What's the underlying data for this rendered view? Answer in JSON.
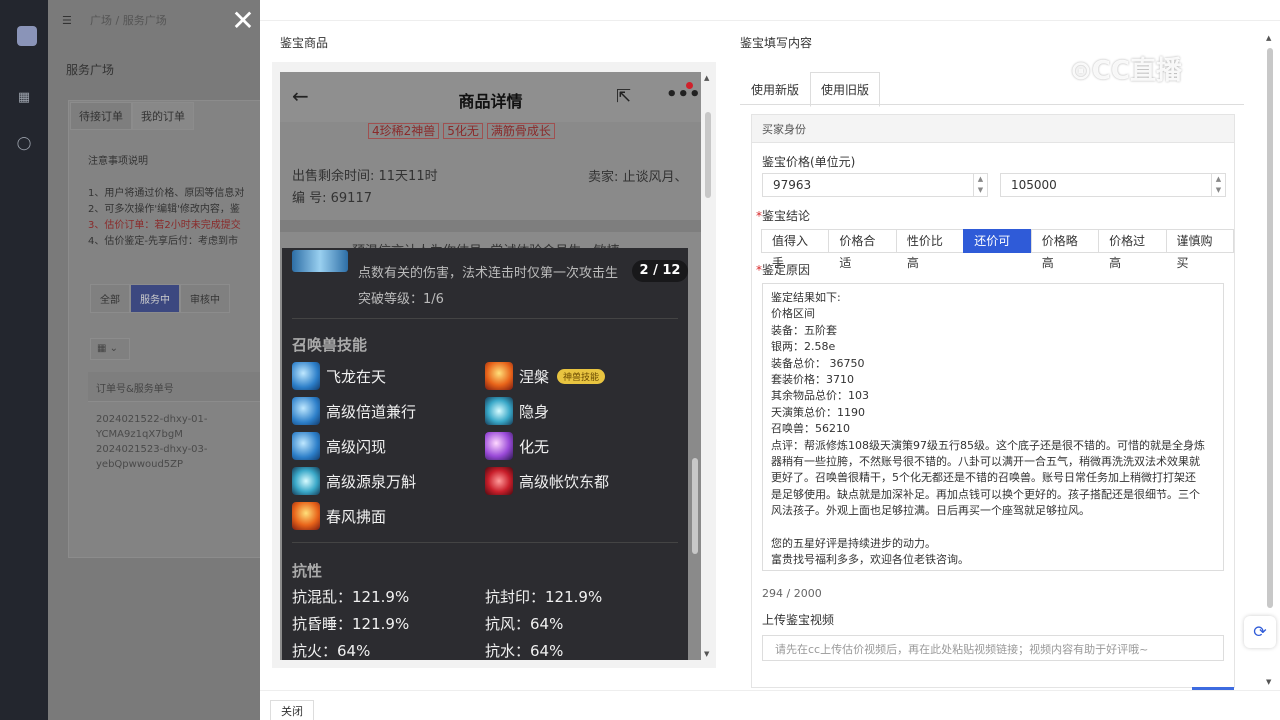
{
  "background": {
    "breadcrumb": "广场 / 服务广场",
    "title": "服务广场",
    "tabs": [
      "待接订单",
      "我的订单"
    ],
    "note_title": "注意事项说明",
    "notes": [
      {
        "text": "1、用户将通过价格、原因等信息对",
        "red": false
      },
      {
        "text": "2、可多次操作'编辑'修改内容，鉴",
        "red": false
      },
      {
        "text": "3、估价订单：若2小时未完成提交",
        "red": true
      },
      {
        "text": "4、估价鉴定-先享后付：考虑到市",
        "red": false
      }
    ],
    "filters": [
      "全部",
      "服务中",
      "审核中"
    ],
    "grid_select": "▦ ⌄",
    "column_header": "订单号&服务单号",
    "orders": [
      "2024021522-dhxy-01-",
      "YCMA9z1qX7bgM",
      "2024021523-dhxy-03-",
      "yebQpwwoud5ZP"
    ]
  },
  "left_panel": {
    "title": "鉴宝商品",
    "phone": {
      "back": "←",
      "title": "商品详情",
      "share": "⇱",
      "more": "•••",
      "tags": [
        "4珍稀2神兽",
        "5化无",
        "满筋骨成长"
      ],
      "time_label": "出售剩余时间: 11天11时",
      "id_label": "编 号: 69117",
      "seller_label": "卖家: 止谈风月、",
      "promo": "预温信言计人为你估号 ·尝试体验会员生 · 敏捷",
      "overlay": {
        "desc": "点数有关的伤害，法术连击时仅第一次攻击生",
        "level": "突破等级：1/6",
        "pager": "2 / 12",
        "skills_title": "召唤兽技能",
        "skills_left": [
          {
            "name": "飞龙在天",
            "icon": "ic-blue"
          },
          {
            "name": "高级倍道兼行",
            "icon": "ic-blue"
          },
          {
            "name": "高级闪现",
            "icon": "ic-blue"
          },
          {
            "name": "高级源泉万斛",
            "icon": "ic-cyan"
          },
          {
            "name": "春风拂面",
            "icon": "ic-fire"
          }
        ],
        "skills_right": [
          {
            "name": "涅槃",
            "icon": "ic-fire",
            "badge": "神兽技能"
          },
          {
            "name": "隐身",
            "icon": "ic-cyan",
            "badge": ""
          },
          {
            "name": "化无",
            "icon": "ic-purple",
            "badge": ""
          },
          {
            "name": "高级帐饮东都",
            "icon": "ic-red",
            "badge": ""
          }
        ],
        "resist_title": "抗性",
        "resists_left": [
          "抗混乱：121.9%",
          "抗昏睡：121.9%",
          "抗火：64%"
        ],
        "resists_right": [
          "抗封印：121.9%",
          "抗风：64%",
          "抗水：64%"
        ]
      }
    }
  },
  "right_panel": {
    "title": "鉴宝填写内容",
    "tabs": [
      "使用新版",
      "使用旧版"
    ],
    "box_head": "买家身份",
    "price_label": "鉴宝价格(单位元)",
    "price_low": "97963",
    "price_high": "105000",
    "conclusion_label": "鉴宝结论",
    "conclusions": [
      "值得入手",
      "价格合适",
      "性价比高",
      "还价可入",
      "价格略高",
      "价格过高",
      "谨慎购买"
    ],
    "selected_conclusion": "还价可入",
    "reason_label": "鉴定原因",
    "reason_lines": [
      "鉴定结果如下:",
      "价格区间",
      "装备：五阶套",
      "银两：2.58e",
      "装备总价： 36750",
      "套装价格：3710",
      "其余物品总价：103",
      "天演策总价：1190",
      "召唤兽：56210",
      "点评：帮派修炼108级天演策97级五行85级。这个底子还是很不错的。可惜的就是全身炼",
      "器稍有一些拉胯，不然账号很不错的。八卦可以满开一合五气，稍微再洗洗双法术效果就",
      "更好了。召唤兽很精干，5个化无都还是不错的召唤兽。账号日常任务加上稍微打打架还",
      "是足够使用。缺点就是加深补足。再加点钱可以换个更好的。孩子搭配还是很细节。三个",
      "风法孩子。外观上面也足够拉满。日后再买一个座驾就足够拉风。",
      "",
      "您的五星好评是持续进步的动力。",
      "富贵找号福利多多，欢迎各位老铁咨询。"
    ],
    "counter": "294 / 2000",
    "video_label": "上传鉴宝视频",
    "video_placeholder": "请先在cc上传估价视频后，再在此处粘贴视频链接；视频内容有助于好评哦~"
  },
  "footer": {
    "close": "关闭"
  },
  "watermark": "⊙CC直播",
  "colors": {
    "accent": "#2f5bd8",
    "required": "#d8282a",
    "overlay": "#2c2c30"
  }
}
